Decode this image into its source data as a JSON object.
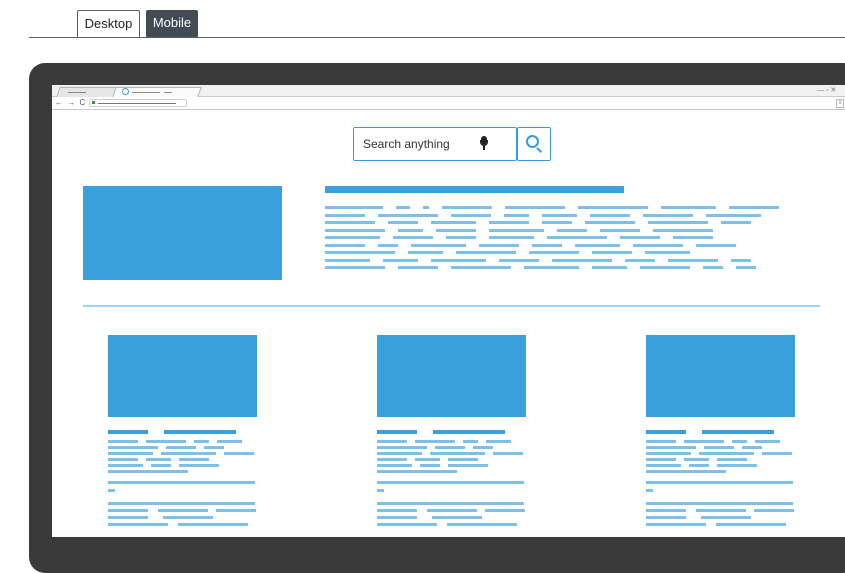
{
  "tabs": {
    "desktop_label": "Desktop",
    "mobile_label": "Mobile",
    "selected": "Desktop"
  },
  "browser": {
    "window_controls": "— ▫ ✕",
    "nav_buttons": "← → C",
    "menu_icon": "≡"
  },
  "search": {
    "placeholder": "Search anything"
  },
  "icons": {
    "mic": "microphone-icon",
    "search": "magnifier-icon"
  },
  "colors": {
    "accent": "#3aa0dc",
    "text_lines": "#7cc0ea",
    "divider": "#9fd3f0",
    "device_frame": "#3a3a3a",
    "active_tab": "#444b54"
  }
}
